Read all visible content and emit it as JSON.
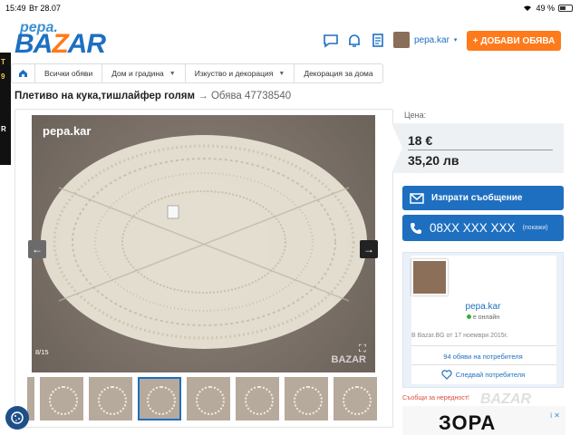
{
  "status_bar": {
    "time": "15:49",
    "date": "Вт 28.07",
    "battery": "49 %"
  },
  "header": {
    "logo_top": "pepa.",
    "logo_main_a": "BA",
    "logo_main_b": "Z",
    "logo_main_c": "AR",
    "username": "pepa.kar",
    "add_button": "+ ДОБАВИ ОБЯВА"
  },
  "breadcrumb": {
    "items": [
      {
        "label": "Всички обяви",
        "caret": false
      },
      {
        "label": "Дом и градина",
        "caret": true
      },
      {
        "label": "Изкуство и декорация",
        "caret": true
      },
      {
        "label": "Декорация за дома",
        "caret": false
      }
    ]
  },
  "listing": {
    "title": "Плетиво на кука,тишлайфер голям",
    "arrow": "→",
    "ad_number": "Обява 47738540"
  },
  "gallery": {
    "watermark_top": "pepa.kar",
    "watermark_bottom": "BAZAR",
    "counter": "8/15",
    "thumb_count": 8,
    "active_thumb": 3
  },
  "price": {
    "label": "Цена:",
    "eur": "18 €",
    "lv": "35,20 лв"
  },
  "contact": {
    "message_button": "Изпрати съобщение",
    "phone_number": "08XX XXX XXX",
    "phone_show": "(покажи)"
  },
  "seller": {
    "name": "pepa.kar",
    "status": "е онлайн",
    "since": "В Bazar.BG от 17 ноември 2015г.",
    "ads_link": "94 обяви на потребителя",
    "follow": "Следвай потребителя",
    "report": "Съобщи за нередност!"
  },
  "banner": {
    "brand": "ЗОРА",
    "ad_mark": "i ✕",
    "bazar_watermark": "BAZAR"
  },
  "colors": {
    "brand_blue": "#1e6fc0",
    "accent_orange": "#ff7a1a",
    "report_red": "#e04b3a",
    "online_green": "#3aad3a"
  },
  "icons": [
    "chat-icon",
    "bell-icon",
    "list-icon",
    "home-icon",
    "envelope-icon",
    "phone-icon",
    "heart-icon",
    "fullscreen-icon",
    "cookie-icon"
  ]
}
